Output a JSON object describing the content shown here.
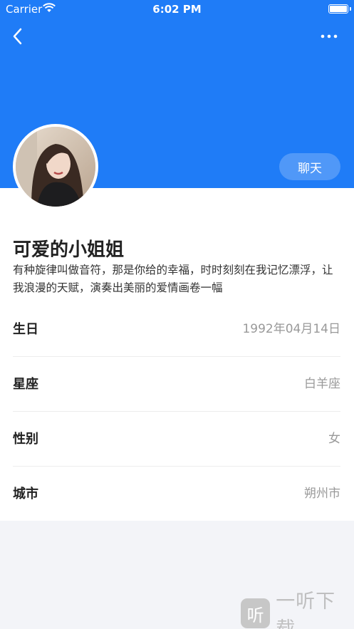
{
  "status_bar": {
    "carrier": "Carrier",
    "time": "6:02 PM"
  },
  "header": {
    "chat_label": "聊天",
    "color": "#1f7cf7"
  },
  "profile": {
    "nickname": "可爱的小姐姐",
    "bio": "有种旋律叫做音符，那是你给的幸福，时时刻刻在我记忆漂浮，让我浪漫的天赋，演奏出美丽的爱情画卷一幅"
  },
  "info": [
    {
      "label": "生日",
      "value": "1992年04月14日"
    },
    {
      "label": "星座",
      "value": "白羊座"
    },
    {
      "label": "性别",
      "value": "女"
    },
    {
      "label": "城市",
      "value": "朔州市"
    }
  ],
  "watermark": {
    "logo": "听",
    "text": "一听下载"
  }
}
